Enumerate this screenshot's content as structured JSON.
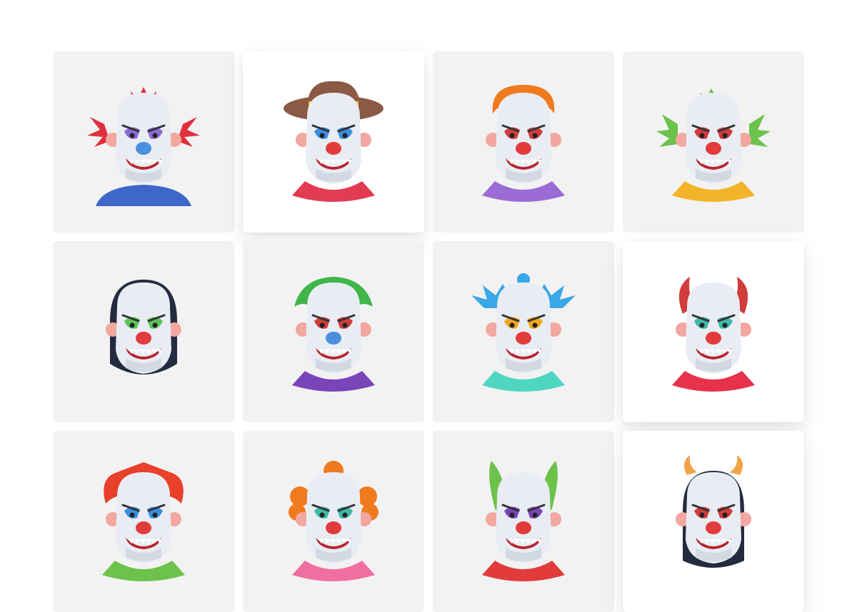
{
  "colors": {
    "tile_bg": "#f2f2f2",
    "tile_raised_bg": "#ffffff",
    "face": "#e9edf3",
    "face_shade": "#d3d9e3",
    "nose": "#e23b3b",
    "mouth": "#b8242f",
    "teeth": "#ffffff"
  },
  "tiles": [
    {
      "icon": "clown-red-mohawk-icon",
      "raised": false,
      "hair": "#e0303c",
      "collar": "#3f67c9",
      "nose": "#4a8fe0",
      "eyes": "#8a6bd6"
    },
    {
      "icon": "clown-cowboy-hat-icon",
      "raised": true,
      "hair": "#8a5a44",
      "collar": "#e23b52",
      "nose": "#e23b3b",
      "eyes": "#3a8fe0"
    },
    {
      "icon": "clown-orange-hair-icon",
      "raised": false,
      "hair": "#f07a1e",
      "collar": "#9b6bd6",
      "nose": "#e23b3b",
      "eyes": "#d13c3c"
    },
    {
      "icon": "clown-green-hair-icon",
      "raised": false,
      "hair": "#6cc24a",
      "collar": "#f4b42a",
      "nose": "#e23b3b",
      "eyes": "#d13c3c"
    },
    {
      "icon": "clown-vampire-icon",
      "raised": false,
      "hair": "#252b3f",
      "collar": "#252b3f",
      "nose": "#e23b3b",
      "eyes": "#5cc35a"
    },
    {
      "icon": "clown-joker-icon",
      "raised": false,
      "hair": "#3fb54a",
      "collar": "#7a45b8",
      "nose": "#4a8fe0",
      "eyes": "#d13c3c"
    },
    {
      "icon": "clown-blue-hair-icon",
      "raised": false,
      "hair": "#3aa7e6",
      "collar": "#4fd6c0",
      "nose": "#e23b3b",
      "eyes": "#f2a71e"
    },
    {
      "icon": "clown-devil-horns-icon",
      "raised": true,
      "hair": "#d13c3c",
      "collar": "#e8324c",
      "nose": "#e23b3b",
      "eyes": "#3fb9a8"
    },
    {
      "icon": "clown-red-hair-icon",
      "raised": false,
      "hair": "#e8402a",
      "collar": "#6cc24a",
      "nose": "#e23b3b",
      "eyes": "#3a8fe0"
    },
    {
      "icon": "clown-orange-curls-icon",
      "raised": false,
      "hair": "#f07a1e",
      "collar": "#f06fa0",
      "nose": "#e23b3b",
      "eyes": "#3fb9a8"
    },
    {
      "icon": "clown-green-spikes-icon",
      "raised": false,
      "hair": "#6cc24a",
      "collar": "#e23b3b",
      "nose": "#e23b3b",
      "eyes": "#7a45b8"
    },
    {
      "icon": "clown-vampire-horns-icon",
      "raised": true,
      "hair": "#252b3f",
      "collar": "#8a5ad6",
      "nose": "#e23b3b",
      "eyes": "#d13c3c"
    }
  ]
}
